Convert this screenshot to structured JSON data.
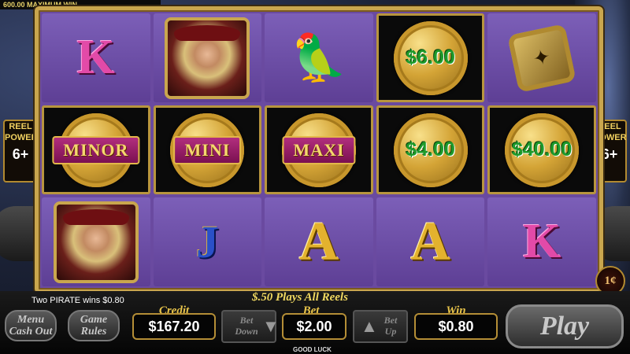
{
  "top_message": "600.00 MAXIMUM WIN",
  "reel_power": {
    "label1": "REEL",
    "label2": "POWER",
    "value": "6+"
  },
  "reels": [
    [
      {
        "type": "letter",
        "value": "K",
        "cls": "K"
      },
      {
        "type": "coin",
        "banner": "MINOR"
      },
      {
        "type": "portrait",
        "name": "pirate-woman"
      }
    ],
    [
      {
        "type": "portrait",
        "name": "pirate-woman"
      },
      {
        "type": "coin",
        "banner": "MINI"
      },
      {
        "type": "letter",
        "value": "J",
        "cls": "J"
      }
    ],
    [
      {
        "type": "parrot",
        "name": "parrot"
      },
      {
        "type": "coin",
        "banner": "MAXI"
      },
      {
        "type": "letter",
        "value": "A",
        "cls": "A"
      }
    ],
    [
      {
        "type": "coin",
        "value": "$6.00"
      },
      {
        "type": "coin",
        "value": "$4.00"
      },
      {
        "type": "letter",
        "value": "A",
        "cls": "A"
      }
    ],
    [
      {
        "type": "compass",
        "name": "compass"
      },
      {
        "type": "coin",
        "value": "$40.00"
      },
      {
        "type": "letter",
        "value": "K",
        "cls": "K"
      }
    ]
  ],
  "denomination": "1¢",
  "status": {
    "win_message": "Two PIRATE wins $0.80",
    "plays_all_reels": "$.50 Plays All Reels",
    "good_luck": "GOOD LUCK"
  },
  "buttons": {
    "menu": "Menu",
    "cash_out": "Cash Out",
    "game": "Game",
    "rules": "Rules",
    "bet": "Bet",
    "down": "Down",
    "up": "Up",
    "play": "Play"
  },
  "meters": {
    "credit_label": "Credit",
    "credit": "$167.20",
    "bet_label": "Bet",
    "bet": "$2.00",
    "win_label": "Win",
    "win": "$0.80"
  }
}
